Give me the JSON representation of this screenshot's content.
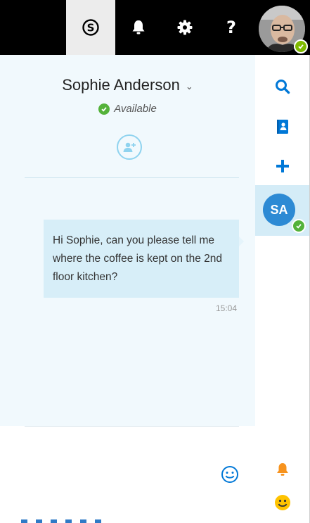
{
  "topbar": {
    "icons": [
      "skype-icon",
      "bell-icon",
      "gear-icon",
      "help-icon"
    ],
    "help_label": "?",
    "user_status_color": "#7fba00"
  },
  "conversation": {
    "contact_name": "Sophie Anderson",
    "presence": "Available",
    "presence_color": "#54b23a",
    "messages": [
      {
        "text": "Hi Sophie, can you please tell me where the coffee is kept on the 2nd floor kitchen?",
        "time": "15:04"
      }
    ]
  },
  "rail": {
    "active_contact_initials": "SA",
    "icons": [
      "search-icon",
      "contacts-icon",
      "add-icon",
      "notification-bell-icon",
      "emoji-icon"
    ]
  },
  "colors": {
    "accent": "#0078d7",
    "bell_orange": "#f7931e",
    "emoji_yellow": "#ffc300"
  }
}
